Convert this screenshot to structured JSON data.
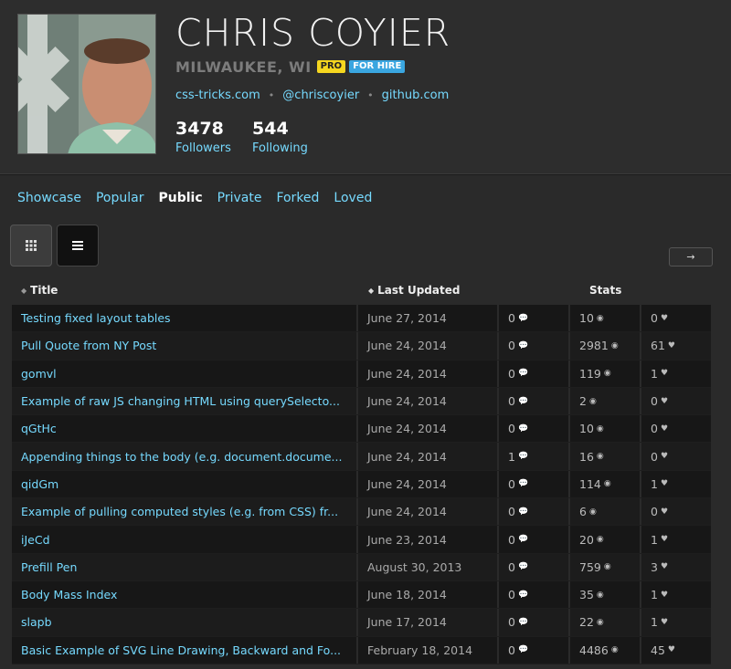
{
  "profile": {
    "name": "CHRIS COYIER",
    "location": "MILWAUKEE, WI",
    "badge_pro": "PRO",
    "badge_hire": "FOR HIRE",
    "links": [
      "css-tricks.com",
      "@chriscoyier",
      "github.com"
    ],
    "link_separator": "•",
    "followers_count": "3478",
    "followers_label": "Followers",
    "following_count": "544",
    "following_label": "Following"
  },
  "tabs": [
    {
      "label": "Showcase",
      "active": false
    },
    {
      "label": "Popular",
      "active": false
    },
    {
      "label": "Public",
      "active": true
    },
    {
      "label": "Private",
      "active": false
    },
    {
      "label": "Forked",
      "active": false
    },
    {
      "label": "Loved",
      "active": false
    }
  ],
  "controls": {
    "grid_view_icon": "grid-icon",
    "list_view_icon": "list-icon",
    "next_icon": "arrow-right-icon",
    "next_label": "→"
  },
  "table": {
    "headers": {
      "title": "Title",
      "updated": "Last Updated",
      "stats": "Stats"
    },
    "rows": [
      {
        "title": "Testing fixed layout tables",
        "date": "June 27, 2014",
        "comments": "0",
        "views": "10",
        "loves": "0"
      },
      {
        "title": "Pull Quote from NY Post",
        "date": "June 24, 2014",
        "comments": "0",
        "views": "2981",
        "loves": "61"
      },
      {
        "title": "gomvl",
        "date": "June 24, 2014",
        "comments": "0",
        "views": "119",
        "loves": "1"
      },
      {
        "title": "Example of raw JS changing HTML using querySelecto...",
        "date": "June 24, 2014",
        "comments": "0",
        "views": "2",
        "loves": "0"
      },
      {
        "title": "qGtHc",
        "date": "June 24, 2014",
        "comments": "0",
        "views": "10",
        "loves": "0"
      },
      {
        "title": "Appending things to the body (e.g. document.docume...",
        "date": "June 24, 2014",
        "comments": "1",
        "views": "16",
        "loves": "0"
      },
      {
        "title": "qidGm",
        "date": "June 24, 2014",
        "comments": "0",
        "views": "114",
        "loves": "1"
      },
      {
        "title": "Example of pulling computed styles (e.g. from CSS) fr...",
        "date": "June 24, 2014",
        "comments": "0",
        "views": "6",
        "loves": "0"
      },
      {
        "title": "iJeCd",
        "date": "June 23, 2014",
        "comments": "0",
        "views": "20",
        "loves": "1"
      },
      {
        "title": "Prefill Pen",
        "date": "August 30, 2013",
        "comments": "0",
        "views": "759",
        "loves": "3"
      },
      {
        "title": "Body Mass Index",
        "date": "June 18, 2014",
        "comments": "0",
        "views": "35",
        "loves": "1"
      },
      {
        "title": "slapb",
        "date": "June 17, 2014",
        "comments": "0",
        "views": "22",
        "loves": "1"
      },
      {
        "title": "Basic Example of SVG Line Drawing, Backward and Fo...",
        "date": "February 18, 2014",
        "comments": "0",
        "views": "4486",
        "loves": "45"
      }
    ]
  },
  "colors": {
    "link": "#76daff",
    "pro_badge": "#f5d61f",
    "hire_badge": "#3aa6e0",
    "background": "#2a2a2a"
  }
}
